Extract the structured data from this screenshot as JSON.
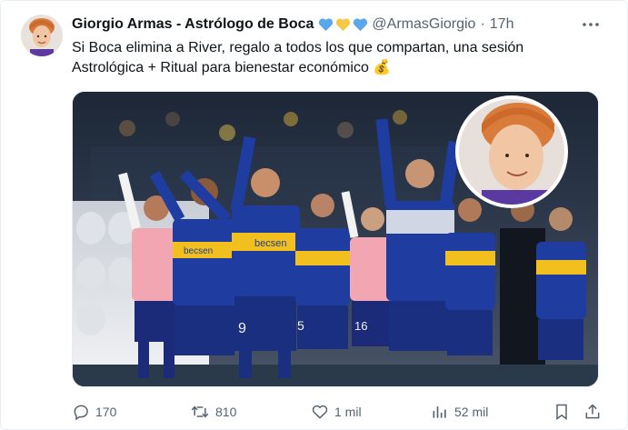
{
  "tweet": {
    "author_name": "Giorgio Armas - Astrólogo de Boca",
    "handle": "@ArmasGiorgio",
    "separator": "·",
    "time": "17h",
    "text_line1": "Si Boca elimina a River, regalo a todos los que compartan, una sesión",
    "text_line2": "Astrológica + Ritual para bienestar económico",
    "money_emoji": "💰",
    "hearts": [
      {
        "icon": "blue-heart",
        "color": "#5aa7ea"
      },
      {
        "icon": "yellow-heart",
        "color": "#f7c846"
      },
      {
        "icon": "blue-heart",
        "color": "#5aa7ea"
      }
    ],
    "media": {
      "jersey_text_front": "becsen",
      "jersey_text_left": "becsen",
      "number_1": "9",
      "number_2": "5",
      "number_3": "16"
    },
    "metrics": {
      "replies": "170",
      "reposts": "810",
      "likes": "1 mil",
      "views": "52 mil"
    }
  },
  "colors": {
    "text_primary": "#0f1419",
    "text_secondary": "#536471",
    "repost_green": "#536471"
  }
}
